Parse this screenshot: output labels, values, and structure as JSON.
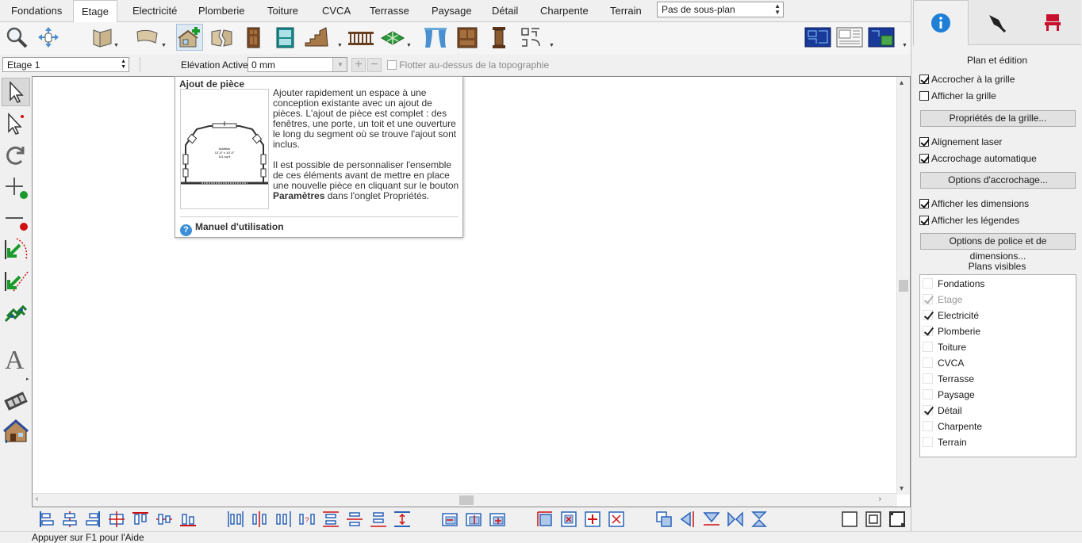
{
  "tabs": [
    {
      "label": "Fondations",
      "active": false
    },
    {
      "label": "Etage",
      "active": true
    },
    {
      "label": "Electricité",
      "active": false
    },
    {
      "label": "Plomberie",
      "active": false
    },
    {
      "label": "Toiture",
      "active": false
    },
    {
      "label": "CVCA",
      "active": false
    },
    {
      "label": "Terrasse",
      "active": false
    },
    {
      "label": "Paysage",
      "active": false
    },
    {
      "label": "Détail",
      "active": false
    },
    {
      "label": "Charpente",
      "active": false
    },
    {
      "label": "Terrain",
      "active": false
    }
  ],
  "subplan": {
    "value": "Pas de sous-plan"
  },
  "toolbar_icons": [
    "zoom-icon",
    "pan-icon",
    "wall-icon",
    "curved-wall-icon",
    "room-addition-icon",
    "broken-wall-icon",
    "door-icon",
    "window-icon",
    "stairs-icon",
    "railing-icon",
    "floor-pattern-icon",
    "curtain-icon",
    "cabinet-icon",
    "column-icon",
    "symbol-icon",
    "plan-view-icon",
    "elevation-view-icon",
    "camera-view-icon"
  ],
  "bar2": {
    "floor": "Etage 1",
    "elevation_label": "Elévation Active:",
    "elevation_value": "0 mm",
    "float_label": "Flotter au-dessus de la topographie"
  },
  "tooltip": {
    "title": "Ajout de pièce",
    "para1": "Ajouter rapidement un espace à une conception existante avec un ajout de pièces. L'ajout de pièce est complet : des fenêtres, une porte, un toit et une ouverture le long du segment où se trouve l'ajout sont inclus.",
    "para2_before": "Il est possible de personnaliser l'ensemble de ces éléments avant de mettre en place une nouvelle pièce en cliquant sur le bouton ",
    "para2_bold": "Paramètres",
    "para2_after": " dans l'onglet Propriétés.",
    "help_link": "Manuel d'utilisation",
    "image_text": {
      "line1": "Addition",
      "line2": "12'-0\" x 10'-0\"",
      "line3": "111 sq ft"
    }
  },
  "status": {
    "text": "Appuyer sur F1 pour l'Aide"
  },
  "panel": {
    "title": "Plan et édition",
    "snap_grid": {
      "label": "Accrocher à la grille",
      "checked": true
    },
    "show_grid": {
      "label": "Afficher la grille",
      "checked": false
    },
    "grid_props_btn": "Propriétés de la grille...",
    "laser": {
      "label": "Alignement laser",
      "checked": true
    },
    "auto_snap": {
      "label": "Accrochage automatique",
      "checked": true
    },
    "snap_options_btn": "Options d'accrochage...",
    "show_dims": {
      "label": "Afficher les dimensions",
      "checked": true
    },
    "show_labels": {
      "label": "Afficher les légendes",
      "checked": true
    },
    "font_dims_btn": "Options de police et de dimensions...",
    "plans_title": "Plans visibles",
    "plans": [
      {
        "label": "Fondations",
        "checked": false,
        "disabled": false
      },
      {
        "label": "Etage",
        "checked": true,
        "disabled": true
      },
      {
        "label": "Electricité",
        "checked": true,
        "disabled": false
      },
      {
        "label": "Plomberie",
        "checked": true,
        "disabled": false
      },
      {
        "label": "Toiture",
        "checked": false,
        "disabled": false
      },
      {
        "label": "CVCA",
        "checked": false,
        "disabled": false
      },
      {
        "label": "Terrasse",
        "checked": false,
        "disabled": false
      },
      {
        "label": "Paysage",
        "checked": false,
        "disabled": false
      },
      {
        "label": "Détail",
        "checked": true,
        "disabled": false
      },
      {
        "label": "Charpente",
        "checked": false,
        "disabled": false
      },
      {
        "label": "Terrain",
        "checked": false,
        "disabled": false
      }
    ]
  },
  "colors": {
    "accent": "#1e7fd6",
    "alignment_red": "#d01010",
    "alignment_blue": "#2a63b8",
    "chair_red": "#c8102e"
  }
}
